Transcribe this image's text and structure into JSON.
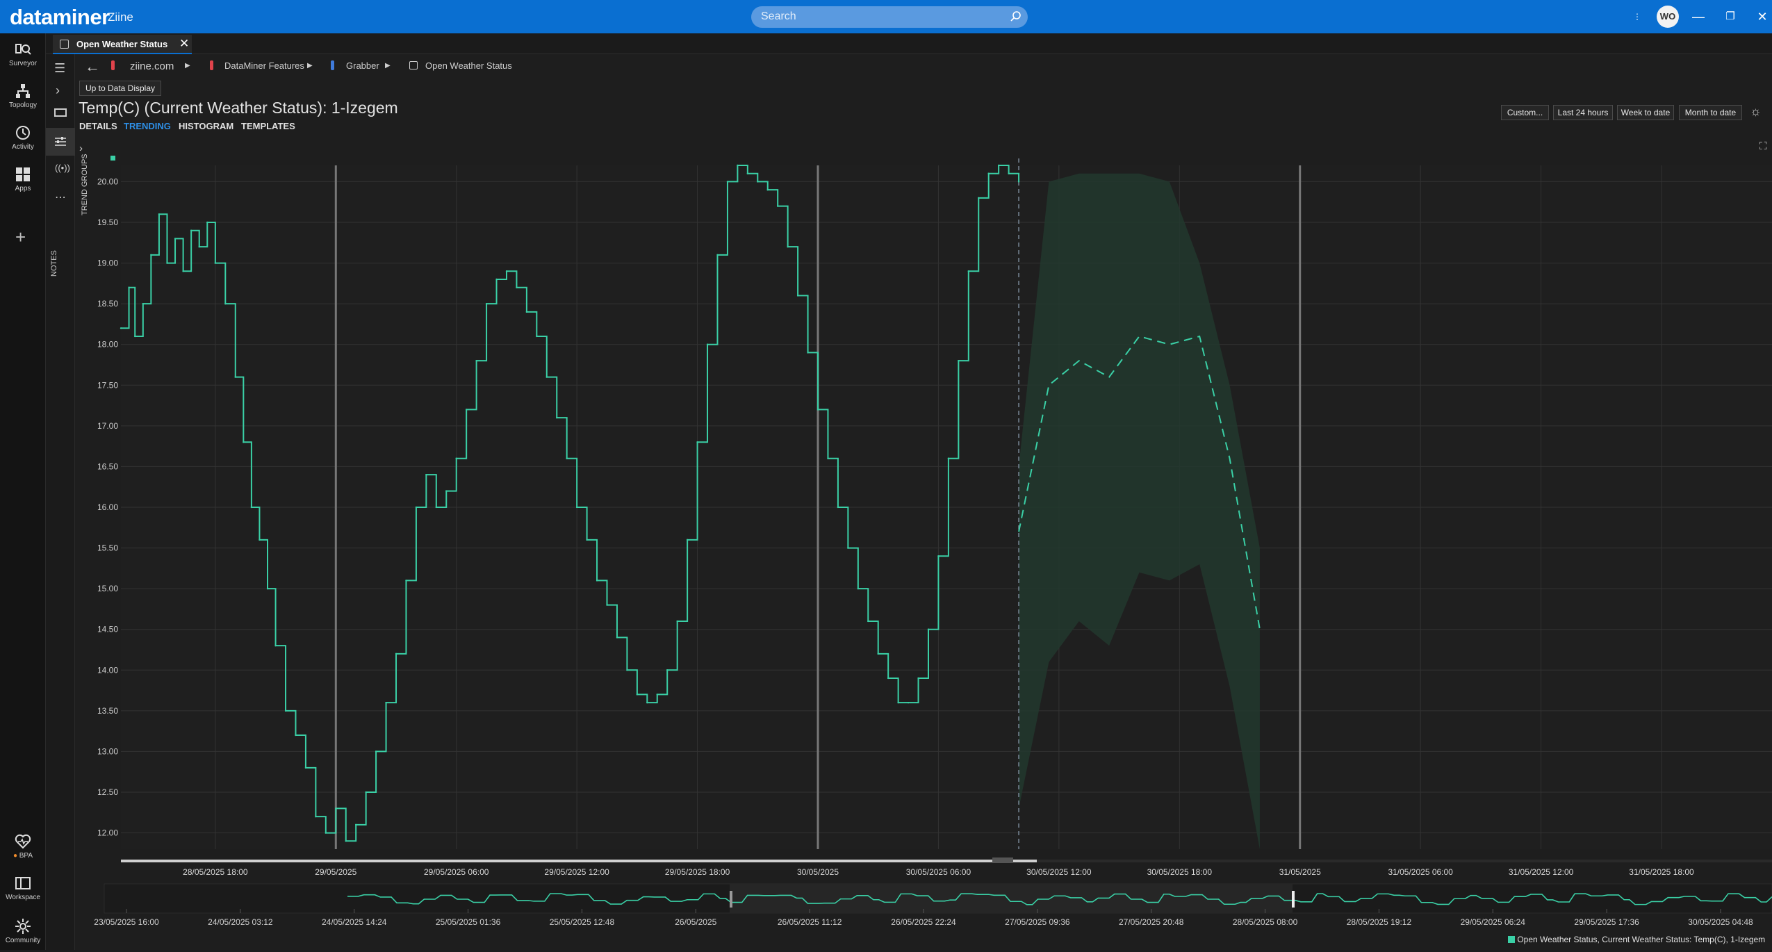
{
  "app": {
    "brand": "dataminer",
    "system_name": "Ziine"
  },
  "search": {
    "placeholder": "Search"
  },
  "user": {
    "initials": "WO"
  },
  "left_nav": [
    {
      "id": "surveyor",
      "label": "Surveyor",
      "icon": "surveyor-icon"
    },
    {
      "id": "topology",
      "label": "Topology",
      "icon": "topology-icon"
    },
    {
      "id": "activity",
      "label": "Activity",
      "icon": "activity-icon"
    },
    {
      "id": "apps",
      "label": "Apps",
      "icon": "apps-icon"
    }
  ],
  "left_nav_bottom": [
    {
      "id": "bpa",
      "label": "BPA",
      "icon": "heartbeat-icon"
    },
    {
      "id": "workspace",
      "label": "Workspace",
      "icon": "workspace-icon"
    },
    {
      "id": "community",
      "label": "Community",
      "icon": "community-icon"
    }
  ],
  "tab": {
    "label": "Open Weather Status"
  },
  "breadcrumbs": [
    {
      "label": "ziine.com",
      "color": "#e0434b"
    },
    {
      "label": "DataMiner Features",
      "color": "#e0434b"
    },
    {
      "label": "Grabber",
      "color": "#3f7bdc"
    },
    {
      "label": "Open Weather Status",
      "color": ""
    }
  ],
  "up_button": "Up to Data Display",
  "page_title": "Temp(C) (Current Weather Status): 1-Izegem",
  "subtabs": [
    {
      "label": "DETAILS",
      "active": false
    },
    {
      "label": "TRENDING",
      "active": true
    },
    {
      "label": "HISTOGRAM",
      "active": false
    },
    {
      "label": "TEMPLATES",
      "active": false
    }
  ],
  "range_buttons": [
    "Custom...",
    "Last 24 hours",
    "Week to date",
    "Month to date"
  ],
  "side_labels": {
    "trend_groups": "TREND GROUPS",
    "notes": "NOTES"
  },
  "legend": "Open Weather Status, Current Weather Status: Temp(C), 1-Izegem",
  "colors": {
    "accent": "#0a6fd1",
    "series": "#3ad0a6",
    "forecast_band": "#22382e"
  },
  "chart_data": {
    "type": "line",
    "y_ticks": [
      "20.00",
      "19.50",
      "19.00",
      "18.50",
      "18.00",
      "17.50",
      "17.00",
      "16.50",
      "16.00",
      "15.50",
      "15.00",
      "14.50",
      "14.00",
      "13.50",
      "13.00",
      "12.50",
      "12.00"
    ],
    "ylim": [
      11.8,
      20.2
    ],
    "x_tick_labels": [
      "28/05/2025 18:00",
      "29/05/2025",
      "29/05/2025 06:00",
      "29/05/2025 12:00",
      "29/05/2025 18:00",
      "30/05/2025",
      "30/05/2025 06:00",
      "30/05/2025 12:00",
      "30/05/2025 18:00",
      "31/05/2025",
      "31/05/2025 06:00",
      "31/05/2025 12:00",
      "31/05/2025 18:00"
    ],
    "x_hours": [
      -6,
      0,
      6,
      12,
      18,
      24,
      30,
      36,
      42,
      48,
      54,
      60,
      66
    ],
    "x_range_hours": [
      -10.7,
      71.5
    ],
    "day_separators_hours": [
      0,
      24,
      48
    ],
    "now_hours": 34.0,
    "series": [
      {
        "name": "Open Weather Status, Current Weather Status: Temp(C), 1-Izegem",
        "x_hours": [
          -10.7,
          -10.3,
          -10,
          -9.6,
          -9.2,
          -8.8,
          -8.4,
          -8,
          -7.6,
          -7.2,
          -6.8,
          -6.4,
          -6,
          -5.5,
          -5,
          -4.6,
          -4.2,
          -3.8,
          -3.4,
          -3,
          -2.5,
          -2,
          -1.5,
          -1,
          -0.5,
          0,
          0.5,
          1,
          1.5,
          2,
          2.5,
          3,
          3.5,
          4,
          4.5,
          5,
          5.5,
          6,
          6.5,
          7,
          7.5,
          8,
          8.5,
          9,
          9.5,
          10,
          10.5,
          11,
          11.5,
          12,
          12.5,
          13,
          13.5,
          14,
          14.5,
          15,
          15.5,
          16,
          16.5,
          17,
          17.5,
          18,
          18.5,
          19,
          19.5,
          20,
          20.5,
          21,
          21.5,
          22,
          22.5,
          23,
          23.5,
          24,
          24.5,
          25,
          25.5,
          26,
          26.5,
          27,
          27.5,
          28,
          28.5,
          29,
          29.5,
          30,
          30.5,
          31,
          31.5,
          32,
          32.5,
          33,
          33.5,
          34
        ],
        "values": [
          18.2,
          18.7,
          18.1,
          18.5,
          19.1,
          19.6,
          19.0,
          19.3,
          18.9,
          19.4,
          19.2,
          19.5,
          19.0,
          18.5,
          17.6,
          16.8,
          16.0,
          15.6,
          15.0,
          14.3,
          13.5,
          13.2,
          12.8,
          12.2,
          12.0,
          12.3,
          11.9,
          12.1,
          12.5,
          13.0,
          13.6,
          14.2,
          15.1,
          16.0,
          16.4,
          16.0,
          16.2,
          16.6,
          17.2,
          17.8,
          18.5,
          18.8,
          18.9,
          18.7,
          18.4,
          18.1,
          17.6,
          17.1,
          16.6,
          16.0,
          15.6,
          15.1,
          14.8,
          14.4,
          14.0,
          13.7,
          13.6,
          13.7,
          14.0,
          14.6,
          15.6,
          16.8,
          18.0,
          19.1,
          20.0,
          20.2,
          20.1,
          20.0,
          19.9,
          19.7,
          19.2,
          18.6,
          17.9,
          17.2,
          16.6,
          16.0,
          15.5,
          15.0,
          14.6,
          14.2,
          13.9,
          13.6,
          13.6,
          13.9,
          14.5,
          15.4,
          16.6,
          17.8,
          18.9,
          19.8,
          20.1,
          20.2,
          20.1,
          20.0
        ]
      }
    ],
    "forecast": {
      "x_hours": [
        34,
        35.5,
        37,
        38.5,
        40,
        41.5,
        43,
        44.5,
        46
      ],
      "values": [
        15.7,
        17.5,
        17.8,
        17.6,
        18.1,
        18.0,
        18.1,
        16.6,
        14.5
      ],
      "band_upper": [
        16.5,
        20.0,
        20.1,
        20.1,
        20.1,
        20.0,
        19.0,
        17.5,
        15.5
      ],
      "band_lower": [
        12.3,
        14.1,
        14.6,
        14.3,
        15.2,
        15.1,
        15.3,
        13.8,
        11.8
      ]
    },
    "overview_x_labels": [
      "23/05/2025 16:00",
      "24/05/2025 03:12",
      "24/05/2025 14:24",
      "25/05/2025 01:36",
      "25/05/2025 12:48",
      "26/05/2025",
      "26/05/2025 11:12",
      "26/05/2025 22:24",
      "27/05/2025 09:36",
      "27/05/2025 20:48",
      "28/05/2025 08:00",
      "28/05/2025 19:12",
      "29/05/2025 06:24",
      "29/05/2025 17:36",
      "30/05/2025 04:48"
    ]
  }
}
